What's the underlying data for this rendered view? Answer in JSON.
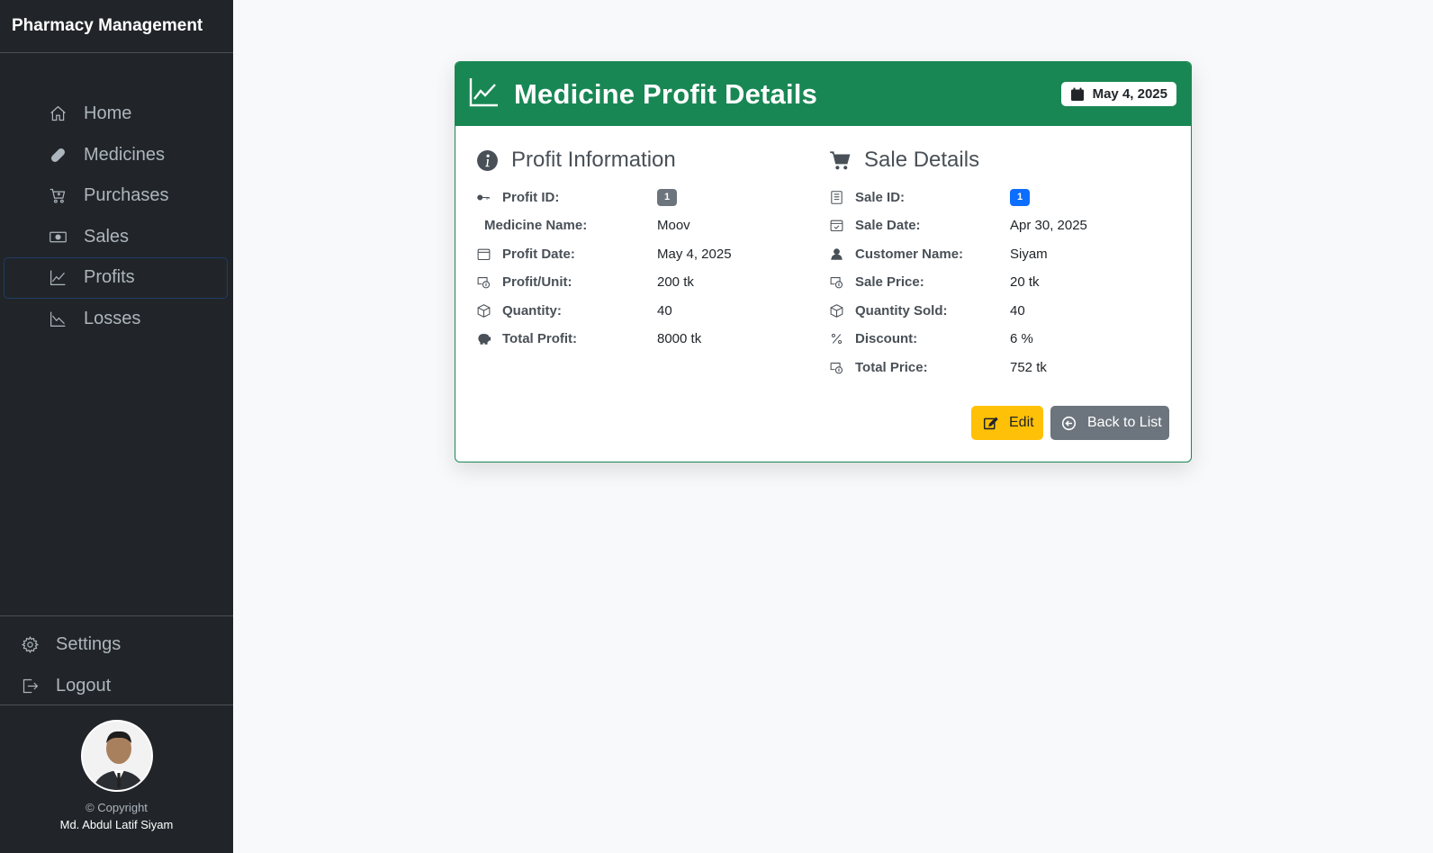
{
  "sidebar": {
    "brand": "Pharmacy Management",
    "items": [
      {
        "label": "Home",
        "icon": "house-icon"
      },
      {
        "label": "Medicines",
        "icon": "capsule-icon"
      },
      {
        "label": "Purchases",
        "icon": "cart-plus-icon"
      },
      {
        "label": "Sales",
        "icon": "cash-icon"
      },
      {
        "label": "Profits",
        "icon": "graph-up-icon",
        "active": true
      },
      {
        "label": "Losses",
        "icon": "graph-down-icon"
      }
    ],
    "bottom": [
      {
        "label": "Settings",
        "icon": "gear-icon"
      },
      {
        "label": "Logout",
        "icon": "logout-icon"
      }
    ],
    "copyright": "© Copyright",
    "author": "Md. Abdul Latif Siyam"
  },
  "card": {
    "title": "Medicine Profit Details",
    "date_badge": "May 4, 2025",
    "header_color": "#198754"
  },
  "profit": {
    "title": "Profit Information",
    "rows": [
      {
        "label": "Profit ID:",
        "value": "1",
        "badge": "gray"
      },
      {
        "label": "Medicine Name:",
        "value": "Moov"
      },
      {
        "label": "Profit Date:",
        "value": "May 4, 2025"
      },
      {
        "label": "Profit/Unit:",
        "value": "200 tk"
      },
      {
        "label": "Quantity:",
        "value": "40"
      },
      {
        "label": "Total Profit:",
        "value": "8000 tk"
      }
    ]
  },
  "sale": {
    "title": "Sale Details",
    "rows": [
      {
        "label": "Sale ID:",
        "value": "1",
        "badge": "blue"
      },
      {
        "label": "Sale Date:",
        "value": "Apr 30, 2025"
      },
      {
        "label": "Customer Name:",
        "value": "Siyam"
      },
      {
        "label": "Sale Price:",
        "value": "20 tk"
      },
      {
        "label": "Quantity Sold:",
        "value": "40"
      },
      {
        "label": "Discount:",
        "value": "6 %"
      },
      {
        "label": "Total Price:",
        "value": "752 tk"
      }
    ]
  },
  "actions": {
    "edit_label": "Edit",
    "back_label": "Back to List"
  }
}
